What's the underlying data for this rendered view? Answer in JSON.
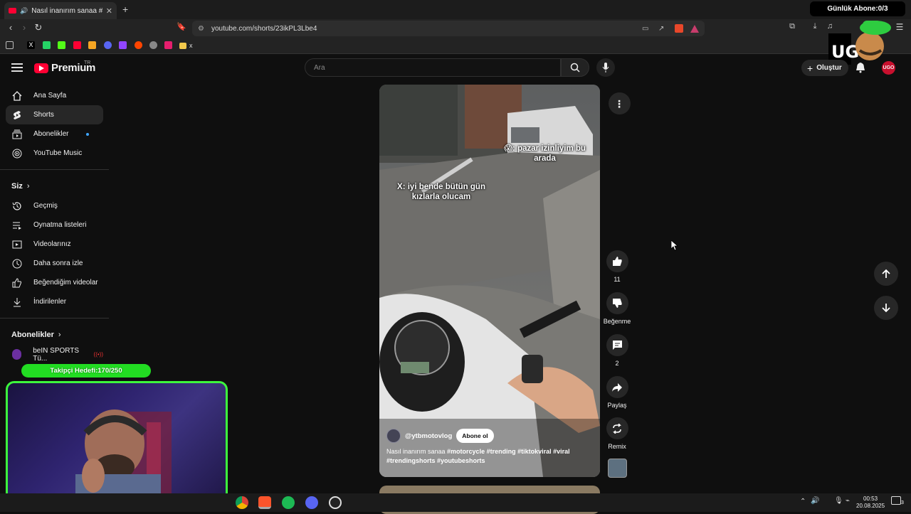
{
  "browser": {
    "tab_title": "Nasıl inanırım sanaa #motorc",
    "tab_close": "✕",
    "new_tab": "+",
    "url": "youtube.com/shorts/23ikPL3Lbe4",
    "bookmark_folder": "x"
  },
  "overlay": {
    "daily_subs": "Günlük Abone:0/3",
    "follower_goal": "Takipçi Hedefi:170/250",
    "follower_progress": 0.68,
    "logo_text": "UGO"
  },
  "header": {
    "logo": "Premium",
    "region": "TR",
    "search_placeholder": "Ara",
    "create_label": "Oluştur"
  },
  "sidebar": {
    "main": [
      {
        "label": "Ana Sayfa",
        "icon": "home-icon"
      },
      {
        "label": "Shorts",
        "icon": "shorts-icon"
      },
      {
        "label": "Abonelikler",
        "icon": "subscriptions-icon"
      },
      {
        "label": "YouTube Music",
        "icon": "music-icon"
      }
    ],
    "you_heading": "Siz",
    "you": [
      {
        "label": "Geçmiş",
        "icon": "history-icon"
      },
      {
        "label": "Oynatma listeleri",
        "icon": "playlist-icon"
      },
      {
        "label": "Videolarınız",
        "icon": "your-videos-icon"
      },
      {
        "label": "Daha sonra izle",
        "icon": "watch-later-icon"
      },
      {
        "label": "Beğendiğim videolar",
        "icon": "liked-icon"
      },
      {
        "label": "İndirilenler",
        "icon": "download-icon"
      }
    ],
    "subs_heading": "Abonelikler",
    "subs": [
      {
        "label": "beIN SPORTS Tü...",
        "badge": "((•))"
      }
    ]
  },
  "short": {
    "caption_right": "😱: pazar izinliyim bu arada",
    "caption_left": "X: iyi bende bütün gün kızlarla olucam",
    "channel": "@ytbmotovlog",
    "subscribe": "Abone ol",
    "description_plain": "Nasıl inanırım sanaa ",
    "description_tags": "#motorcycle #trending #tiktokviral #viral #trendingshorts #youtubeshorts"
  },
  "actions": {
    "likes": "11",
    "dislike": "Beğenme",
    "comments": "2",
    "share": "Paylaş",
    "remix": "Remix"
  },
  "taskbar": {
    "time": "00:53",
    "date": "20.08.2025",
    "notif": "3"
  }
}
